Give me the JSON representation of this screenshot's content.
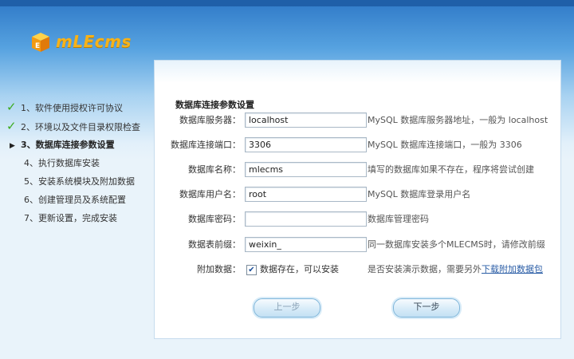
{
  "brand": {
    "logo_text": "mLEcms",
    "accent": "#f6b21a"
  },
  "steps": [
    {
      "label": "1、软件使用授权许可协议",
      "state": "done",
      "icon": "check-icon"
    },
    {
      "label": "2、环境以及文件目录权限检查",
      "state": "done",
      "icon": "check-icon"
    },
    {
      "label": "3、数据库连接参数设置",
      "state": "current",
      "icon": "arrow-right-icon"
    },
    {
      "label": "4、执行数据库安装",
      "state": "todo"
    },
    {
      "label": "5、安装系统模块及附加数据",
      "state": "todo"
    },
    {
      "label": "6、创建管理员及系统配置",
      "state": "todo"
    },
    {
      "label": "7、更新设置，完成安装",
      "state": "todo"
    }
  ],
  "form": {
    "title": "数据库连接参数设置",
    "fields": [
      {
        "label": "数据库服务器：",
        "value": "localhost",
        "hint": "MySQL 数据库服务器地址，一般为 localhost"
      },
      {
        "label": "数据库连接端口：",
        "value": "3306",
        "hint": "MySQL 数据库连接端口，一般为 3306"
      },
      {
        "label": "数据库名称：",
        "value": "mlecms",
        "hint": "填写的数据库如果不存在，程序将尝试创建"
      },
      {
        "label": "数据库用户名：",
        "value": "root",
        "hint": "MySQL 数据库登录用户名"
      },
      {
        "label": "数据库密码：",
        "value": "",
        "hint": "数据库管理密码"
      },
      {
        "label": "数据表前缀：",
        "value": "weixin_",
        "hint": "同一数据库安装多个MLECMS时，请修改前缀"
      }
    ],
    "extra": {
      "label": "附加数据：",
      "checkbox_label": "数据存在，可以安装",
      "checked": true,
      "hint_prefix": "是否安装演示数据，需要另外",
      "link_text": "下载附加数据包"
    }
  },
  "buttons": {
    "prev": "上一步",
    "next": "下一步"
  }
}
